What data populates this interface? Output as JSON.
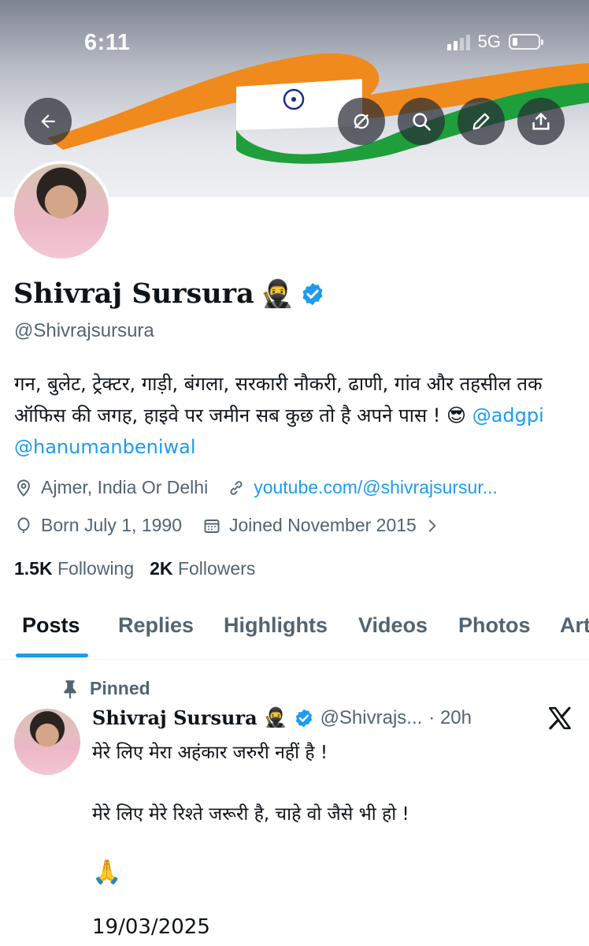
{
  "status_bar": {
    "time": "6:11",
    "network": "5G"
  },
  "profile": {
    "name": "Shivraj Sursura",
    "name_emoji": "🥷",
    "handle": "@Shivrajsursura",
    "bio_text": "गन, बुलेट, ट्रेक्टर, गाड़ी, बंगला, सरकारी नौकरी, ढाणी, गांव और तहसील तक ऑफिस की जगह, हाइवे पर जमीन सब कुछ तो है अपने पास ! 😎 ",
    "bio_mention_1": "@adgpi",
    "bio_mention_2": "@hanumanbeniwal",
    "location": "Ajmer, India Or Delhi",
    "website": "youtube.com/@shivrajsursur...",
    "born": "Born July 1, 1990",
    "joined": "Joined November 2015",
    "following_count": "1.5K",
    "following_label": "Following",
    "followers_count": "2K",
    "followers_label": "Followers"
  },
  "tabs": [
    "Posts",
    "Replies",
    "Highlights",
    "Videos",
    "Photos",
    "Art"
  ],
  "active_tab": "Posts",
  "pinned_post": {
    "pinned_label": "Pinned",
    "author_name": "Shivraj Sursura",
    "author_emoji": "🥷",
    "author_handle": "@Shivrajs...",
    "time": "· 20h",
    "line1": "मेरे लिए मेरा अहंकार जरुरी नहीं है !",
    "line2": "मेरे लिए मेरे रिश्ते जरूरी है, चाहे वो जैसे भी हो !",
    "line3": "🙏",
    "line4": "19/03/2025"
  },
  "colors": {
    "accent": "#1d9bf0",
    "secondary_text": "#536471",
    "primary_text": "#0f1419"
  }
}
